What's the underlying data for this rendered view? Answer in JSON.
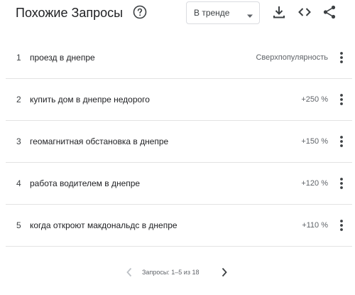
{
  "header": {
    "title": "Похожие Запросы",
    "dropdown_label": "В тренде",
    "icons": [
      "help-icon",
      "chevron-down-icon",
      "download-icon",
      "embed-code-icon",
      "share-icon"
    ]
  },
  "rows": [
    {
      "rank": "1",
      "label": "проезд в днепре",
      "value": "Сверхпопулярность"
    },
    {
      "rank": "2",
      "label": "купить дом в днепре недорого",
      "value": "+250 %"
    },
    {
      "rank": "3",
      "label": "геомагнитная обстановка в днепре",
      "value": "+150 %"
    },
    {
      "rank": "4",
      "label": "работа водителем в днепре",
      "value": "+120 %"
    },
    {
      "rank": "5",
      "label": "когда откроют макдональдс в днепре",
      "value": "+110 %"
    }
  ],
  "pager": {
    "text": "Запросы: 1–5 из 18"
  },
  "colors": {
    "text": "#202124",
    "muted": "#5f6368",
    "divider": "#e3e3e3",
    "icon": "#3c4043",
    "disabled": "#bdc1c6"
  }
}
